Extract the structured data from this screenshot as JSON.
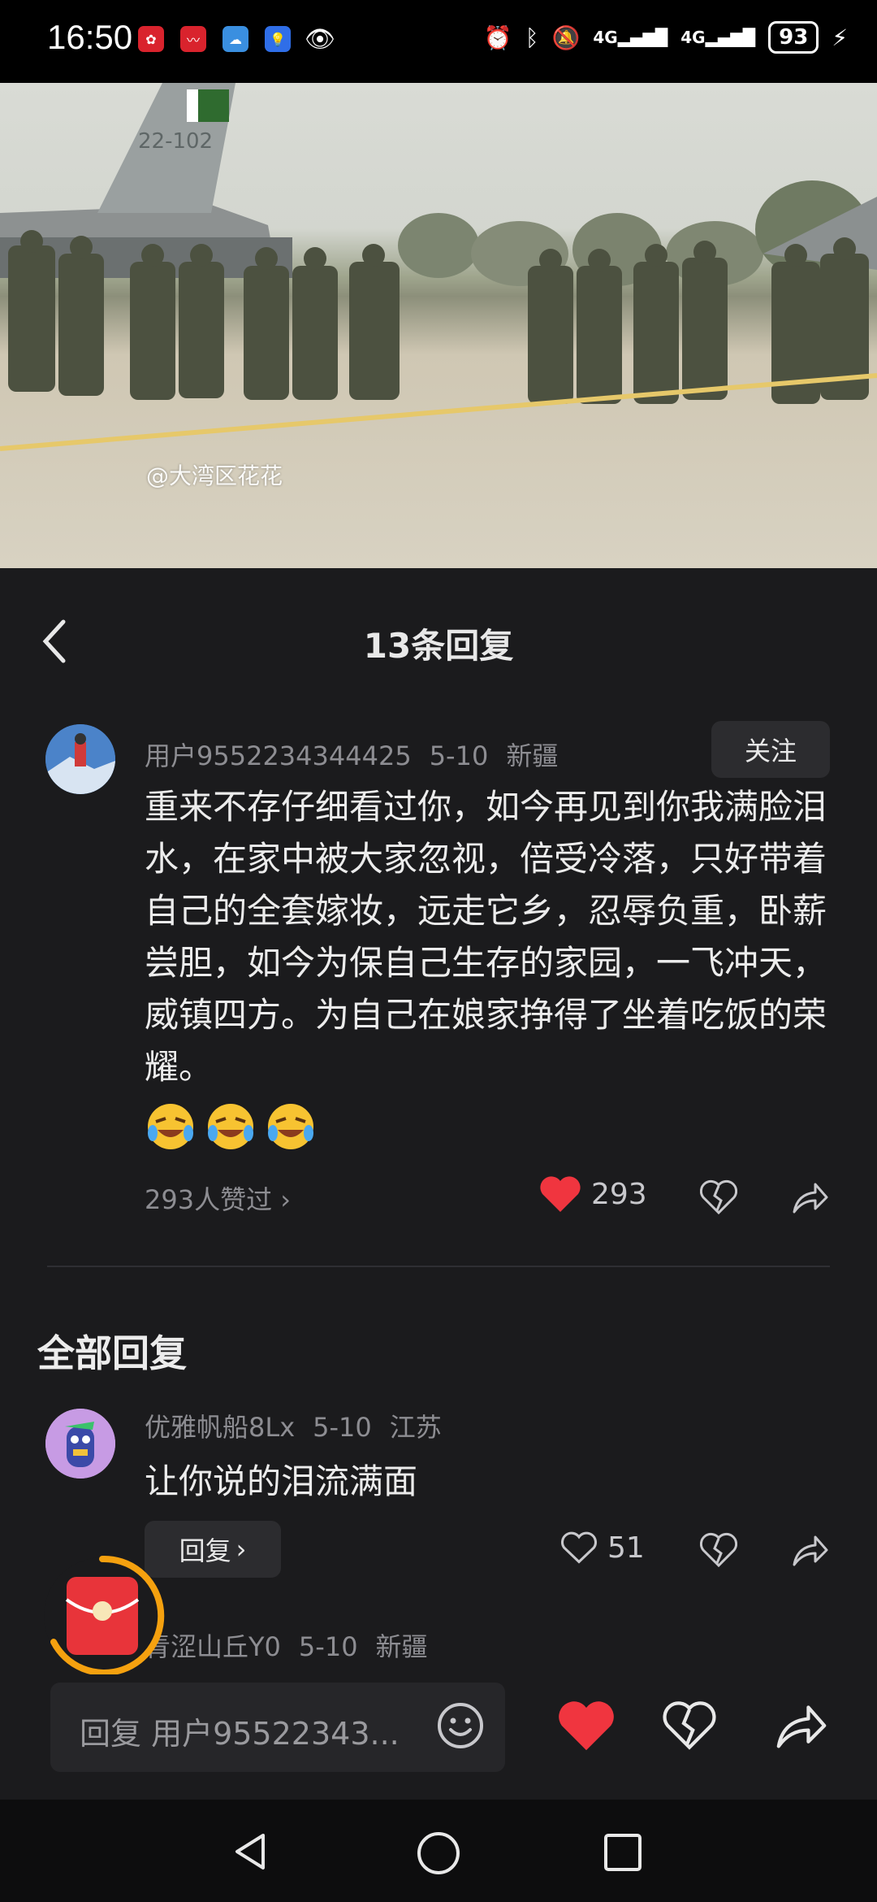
{
  "status_bar": {
    "time": "16:50",
    "network_1": "4G",
    "network_2": "4G",
    "battery": "93"
  },
  "video": {
    "watermark": "@大湾区花花",
    "jet_marking": "22-102"
  },
  "sheet": {
    "title": "13条回复",
    "main_comment": {
      "user": "用户9552234344425",
      "date": "5-10",
      "location": "新疆",
      "follow_label": "关注",
      "text": "重来不存仔细看过你，如今再见到你我满脸泪水，在家中被大家忽视，倍受冷落，只好带着自己的全套嫁妆，远走它乡，忍辱负重，卧薪尝胆，如今为保自己生存的家园，一飞冲天，威镇四方。为自己在娘家挣得了坐着吃饭的荣耀。",
      "emoji_count": 3,
      "liked_by": "293人赞过",
      "like_count": "293"
    },
    "section_title": "全部回复",
    "replies": [
      {
        "user": "优雅帆船8Lx",
        "date": "5-10",
        "location": "江苏",
        "text": "让你说的泪流满面",
        "reply_label": "回复",
        "like_count": "51"
      },
      {
        "user": "青涩山丘Y0",
        "date": "5-10",
        "location": "新疆"
      }
    ]
  },
  "input_bar": {
    "placeholder": "回复 用户95522343..."
  },
  "colors": {
    "background": "#1b1b1d",
    "like_red": "#f0353f",
    "muted_text": "#8d8d92"
  }
}
